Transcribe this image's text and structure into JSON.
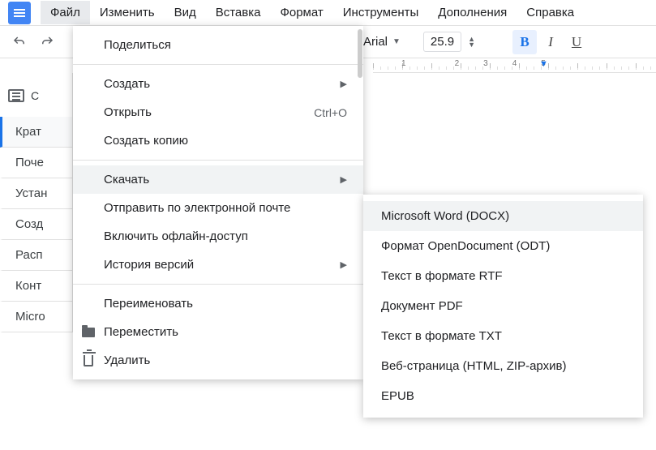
{
  "menubar": [
    "Файл",
    "Изменить",
    "Вид",
    "Вставка",
    "Формат",
    "Инструменты",
    "Дополнения",
    "Справка"
  ],
  "toolbar": {
    "font": "Arial",
    "size": "25.9"
  },
  "ruler": {
    "numbers": [
      "",
      "1",
      "",
      "2",
      "3",
      "4",
      "5"
    ]
  },
  "outline": {
    "header_letter": "С",
    "items": [
      "Крат",
      "Поче",
      "Устан",
      "Созд",
      "Расп",
      "Конт",
      "Micro"
    ]
  },
  "file_menu": {
    "share": "Поделиться",
    "create": "Создать",
    "open": "Открыть",
    "open_shortcut": "Ctrl+O",
    "make_copy": "Создать копию",
    "download": "Скачать",
    "email": "Отправить по электронной почте",
    "offline": "Включить офлайн-доступ",
    "history": "История версий",
    "rename": "Переименовать",
    "move": "Переместить",
    "delete": "Удалить"
  },
  "download_submenu": [
    "Microsoft Word (DOCX)",
    "Формат OpenDocument (ODT)",
    "Текст в формате RTF",
    "Документ PDF",
    "Текст в формате TXT",
    "Веб-страница (HTML, ZIP-архив)",
    "EPUB"
  ]
}
